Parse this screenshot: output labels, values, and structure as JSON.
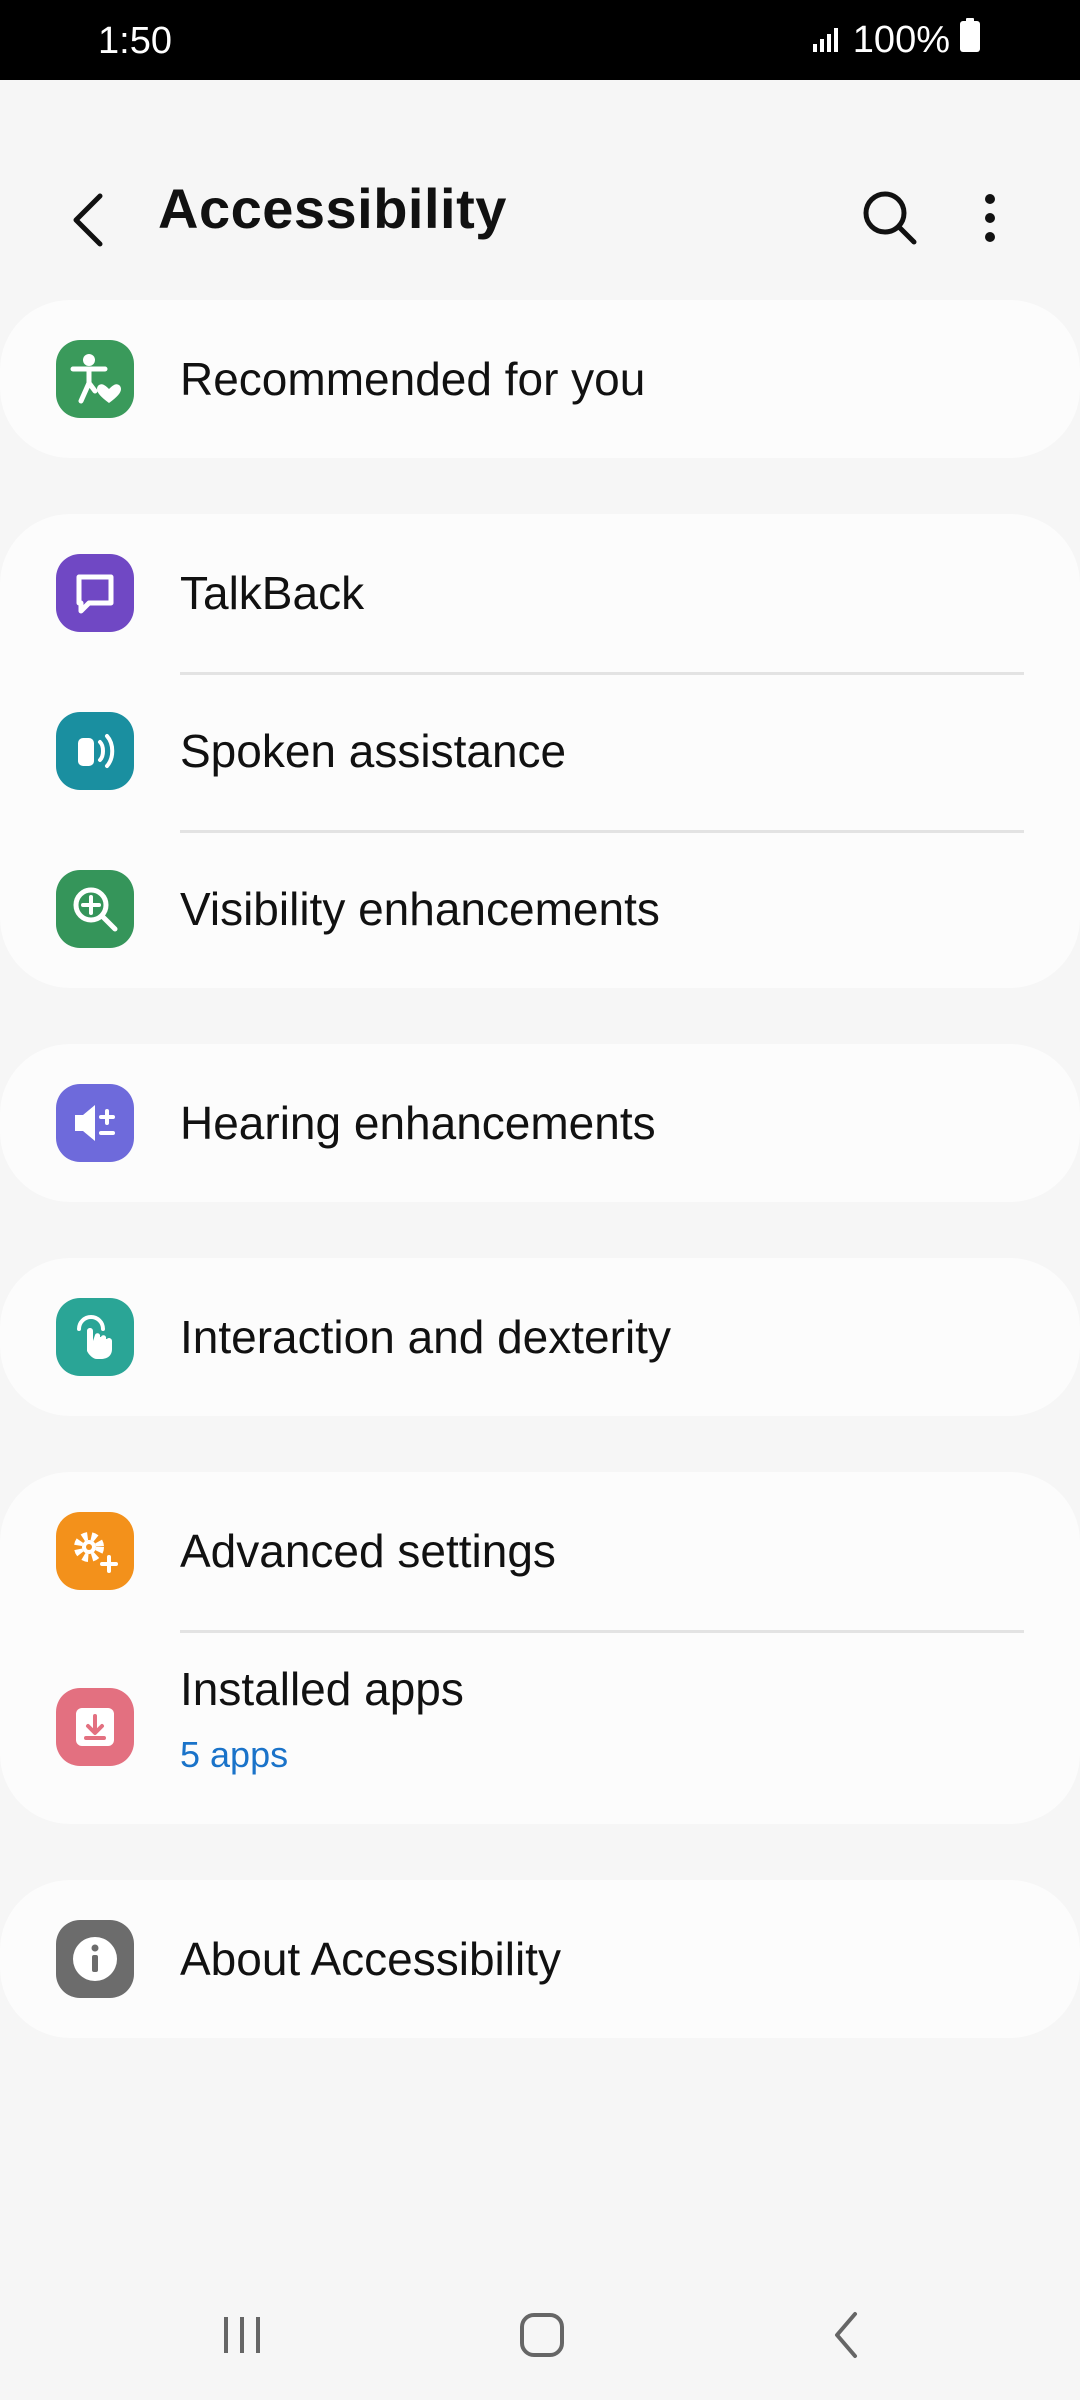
{
  "status": {
    "time": "1:50",
    "battery": "100%"
  },
  "header": {
    "title": "Accessibility"
  },
  "rows": {
    "recommended": {
      "label": "Recommended for you"
    },
    "talkback": {
      "label": "TalkBack"
    },
    "spoken": {
      "label": "Spoken assistance"
    },
    "visibility": {
      "label": "Visibility enhancements"
    },
    "hearing": {
      "label": "Hearing enhancements"
    },
    "interaction": {
      "label": "Interaction and dexterity"
    },
    "advanced": {
      "label": "Advanced settings"
    },
    "installed": {
      "label": "Installed apps",
      "sub": "5 apps"
    },
    "about": {
      "label": "About Accessibility"
    }
  },
  "icons": {
    "recommended": "accessibility-person-icon",
    "talkback": "chat-bubble-icon",
    "spoken": "speaker-waves-icon",
    "visibility": "zoom-in-icon",
    "hearing": "volume-plus-minus-icon",
    "interaction": "touch-hand-icon",
    "advanced": "gear-plus-icon",
    "installed": "download-icon",
    "about": "info-icon"
  },
  "colors": {
    "recommended": "#3a9a5b",
    "talkback": "#7048c4",
    "spoken": "#1a8fa0",
    "visibility": "#35955a",
    "hearing": "#6e6adb",
    "interaction": "#2aa596",
    "advanced": "#f3911b",
    "installed": "#e37080",
    "about": "#6c6c6c",
    "sub_text": "#1a73c9"
  }
}
